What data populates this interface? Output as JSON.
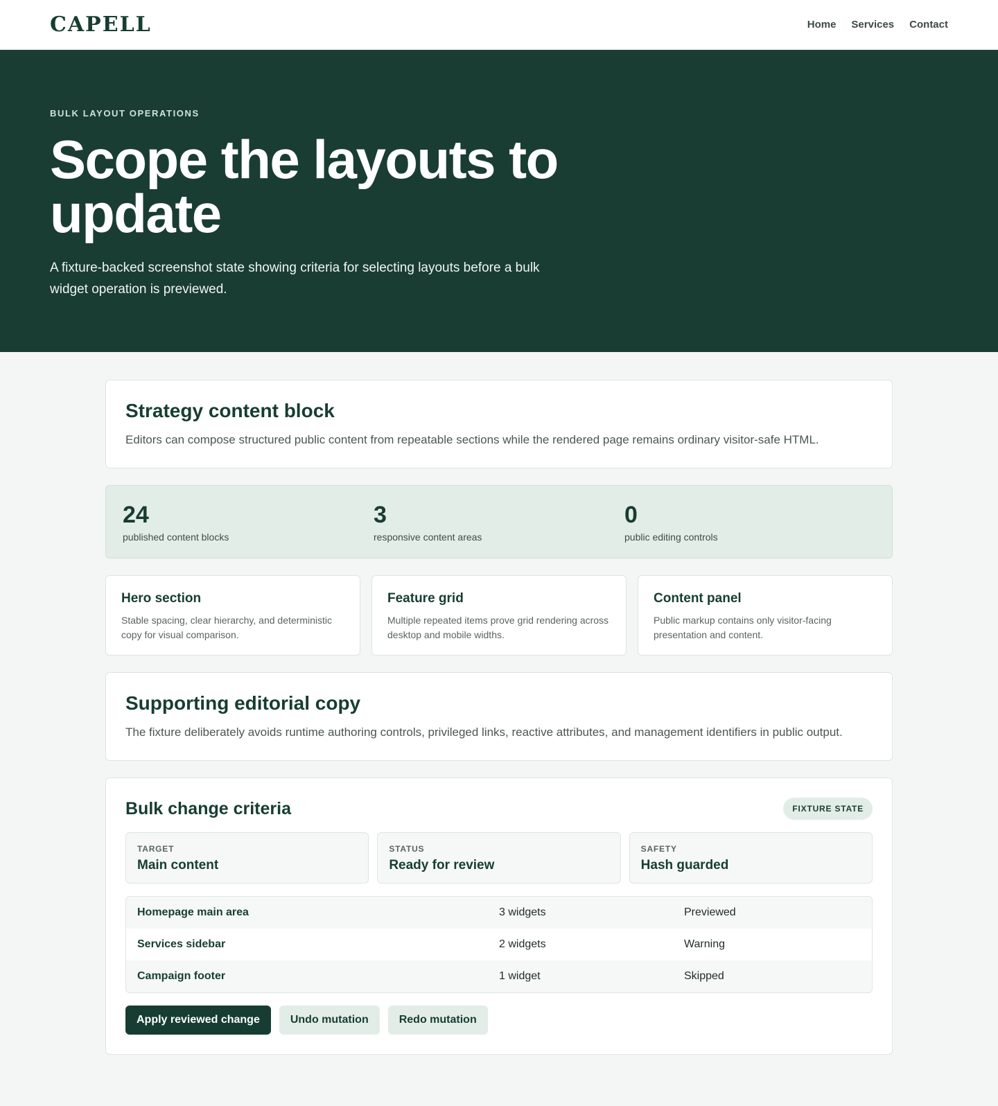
{
  "header": {
    "brand": "CAPELL",
    "nav": [
      "Home",
      "Services",
      "Contact"
    ]
  },
  "hero": {
    "eyebrow": "BULK LAYOUT OPERATIONS",
    "title": "Scope the layouts to update",
    "description": "A fixture-backed screenshot state showing criteria for selecting layouts before a bulk widget operation is previewed."
  },
  "strategy": {
    "title": "Strategy content block",
    "text": "Editors can compose structured public content from repeatable sections while the rendered page remains ordinary visitor-safe HTML."
  },
  "stats": [
    {
      "value": "24",
      "label": "published content blocks"
    },
    {
      "value": "3",
      "label": "responsive content areas"
    },
    {
      "value": "0",
      "label": "public editing controls"
    }
  ],
  "features": [
    {
      "title": "Hero section",
      "text": "Stable spacing, clear hierarchy, and deterministic copy for visual comparison."
    },
    {
      "title": "Feature grid",
      "text": "Multiple repeated items prove grid rendering across desktop and mobile widths."
    },
    {
      "title": "Content panel",
      "text": "Public markup contains only visitor-facing presentation and content."
    }
  ],
  "supporting": {
    "title": "Supporting editorial copy",
    "text": "The fixture deliberately avoids runtime authoring controls, privileged links, reactive attributes, and management identifiers in public output."
  },
  "bulk": {
    "title": "Bulk change criteria",
    "badge": "FIXTURE STATE",
    "criteria": [
      {
        "key": "TARGET",
        "value": "Main content"
      },
      {
        "key": "STATUS",
        "value": "Ready for review"
      },
      {
        "key": "SAFETY",
        "value": "Hash guarded"
      }
    ],
    "rows": [
      {
        "layout": "Homepage main area",
        "widgets": "3 widgets",
        "state": "Previewed"
      },
      {
        "layout": "Services sidebar",
        "widgets": "2 widgets",
        "state": "Warning"
      },
      {
        "layout": "Campaign footer",
        "widgets": "1 widget",
        "state": "Skipped"
      }
    ],
    "actions": {
      "apply": "Apply reviewed change",
      "undo": "Undo mutation",
      "redo": "Redo mutation"
    }
  },
  "colors": {
    "primary": "#1a3d33",
    "accent_light": "#e3ede8",
    "background": "#f3f6f4"
  }
}
